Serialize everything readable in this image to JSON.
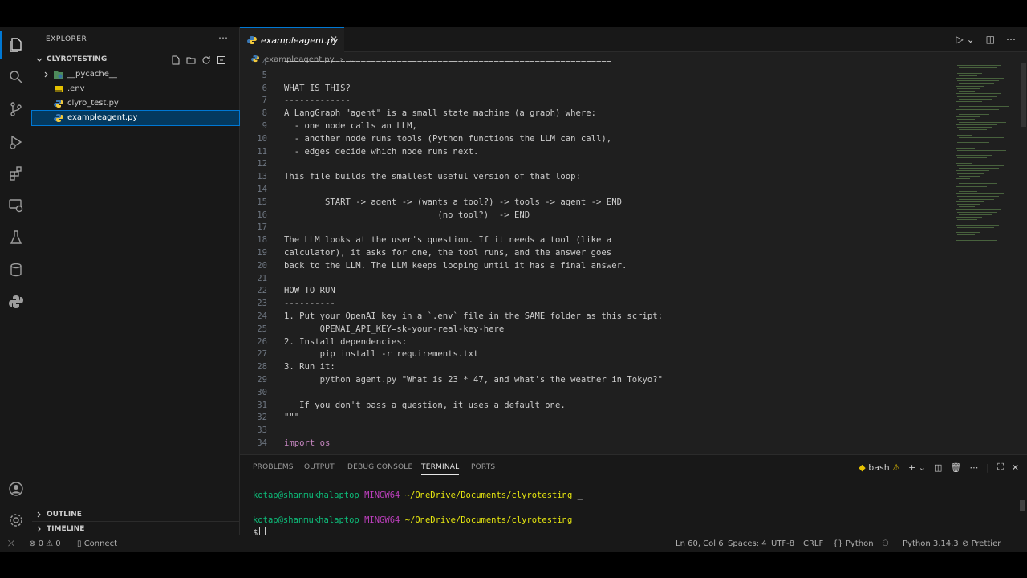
{
  "sidebar": {
    "title": "EXPLORER",
    "workspace": "CLYROTESTING",
    "items": [
      {
        "label": "__pycache__",
        "icon": "folder-icon"
      },
      {
        "label": ".env",
        "icon": "env-file-icon"
      },
      {
        "label": "clyro_test.py",
        "icon": "python-file-icon"
      },
      {
        "label": "exampleagent.py",
        "icon": "python-file-icon"
      }
    ],
    "outline": "OUTLINE",
    "timeline": "TIMELINE"
  },
  "editor": {
    "tab_label": "exampleagent.py",
    "breadcrumb": "exampleagent.py",
    "breadcrumb_more": "...",
    "lines": [
      {
        "n": "4",
        "text": "================================================================",
        "kw": false
      },
      {
        "n": "5",
        "text": "",
        "kw": false
      },
      {
        "n": "6",
        "text": "WHAT IS THIS?",
        "kw": false
      },
      {
        "n": "7",
        "text": "-------------",
        "kw": false
      },
      {
        "n": "8",
        "text": "A LangGraph \"agent\" is a small state machine (a graph) where:",
        "kw": false
      },
      {
        "n": "9",
        "text": "  - one node calls an LLM,",
        "kw": false
      },
      {
        "n": "10",
        "text": "  - another node runs tools (Python functions the LLM can call),",
        "kw": false
      },
      {
        "n": "11",
        "text": "  - edges decide which node runs next.",
        "kw": false
      },
      {
        "n": "12",
        "text": "",
        "kw": false
      },
      {
        "n": "13",
        "text": "This file builds the smallest useful version of that loop:",
        "kw": false
      },
      {
        "n": "14",
        "text": "",
        "kw": false
      },
      {
        "n": "15",
        "text": "        START -> agent -> (wants a tool?) -> tools -> agent -> END",
        "kw": false
      },
      {
        "n": "16",
        "text": "                              (no tool?)  -> END",
        "kw": false
      },
      {
        "n": "17",
        "text": "",
        "kw": false
      },
      {
        "n": "18",
        "text": "The LLM looks at the user's question. If it needs a tool (like a",
        "kw": false
      },
      {
        "n": "19",
        "text": "calculator), it asks for one, the tool runs, and the answer goes",
        "kw": false
      },
      {
        "n": "20",
        "text": "back to the LLM. The LLM keeps looping until it has a final answer.",
        "kw": false
      },
      {
        "n": "21",
        "text": "",
        "kw": false
      },
      {
        "n": "22",
        "text": "HOW TO RUN",
        "kw": false
      },
      {
        "n": "23",
        "text": "----------",
        "kw": false
      },
      {
        "n": "24",
        "text": "1. Put your OpenAI key in a `.env` file in the SAME folder as this script:",
        "kw": false
      },
      {
        "n": "25",
        "text": "       OPENAI_API_KEY=sk-your-real-key-here",
        "kw": false
      },
      {
        "n": "26",
        "text": "2. Install dependencies:",
        "kw": false
      },
      {
        "n": "27",
        "text": "       pip install -r requirements.txt",
        "kw": false
      },
      {
        "n": "28",
        "text": "3. Run it:",
        "kw": false
      },
      {
        "n": "29",
        "text": "       python agent.py \"What is 23 * 47, and what's the weather in Tokyo?\"",
        "kw": false
      },
      {
        "n": "30",
        "text": "",
        "kw": false
      },
      {
        "n": "31",
        "text": "   If you don't pass a question, it uses a default one.",
        "kw": false
      },
      {
        "n": "32",
        "text": "\"\"\"",
        "kw": false
      },
      {
        "n": "33",
        "text": "",
        "kw": false
      },
      {
        "n": "34",
        "text": "import os",
        "kw": true
      }
    ]
  },
  "panel": {
    "tabs": [
      "PROBLEMS",
      "OUTPUT",
      "DEBUG CONSOLE",
      "TERMINAL",
      "PORTS"
    ],
    "active_tab": "TERMINAL",
    "shell": "bash",
    "prompt_user": "kotap@shanmukhalaptop",
    "prompt_host": "MINGW64",
    "prompt_path": "~/OneDrive/Documents/clyrotesting",
    "prompt_suffix": "_",
    "prompt_symbol": "$"
  },
  "status": {
    "errors": "0",
    "warnings": "0",
    "connect": "Connect",
    "position": "Ln 60, Col 6",
    "spaces": "Spaces: 4",
    "encoding": "UTF-8",
    "eol": "CRLF",
    "language": "{} Python",
    "interpreter": "Python 3.14.3",
    "prettier": "Prettier"
  },
  "colors": {
    "accent": "#0078d4",
    "terminal_user": "#0dbc79",
    "terminal_host": "#bc3fbc",
    "terminal_path": "#e5e510",
    "keyword": "#c586c0"
  }
}
